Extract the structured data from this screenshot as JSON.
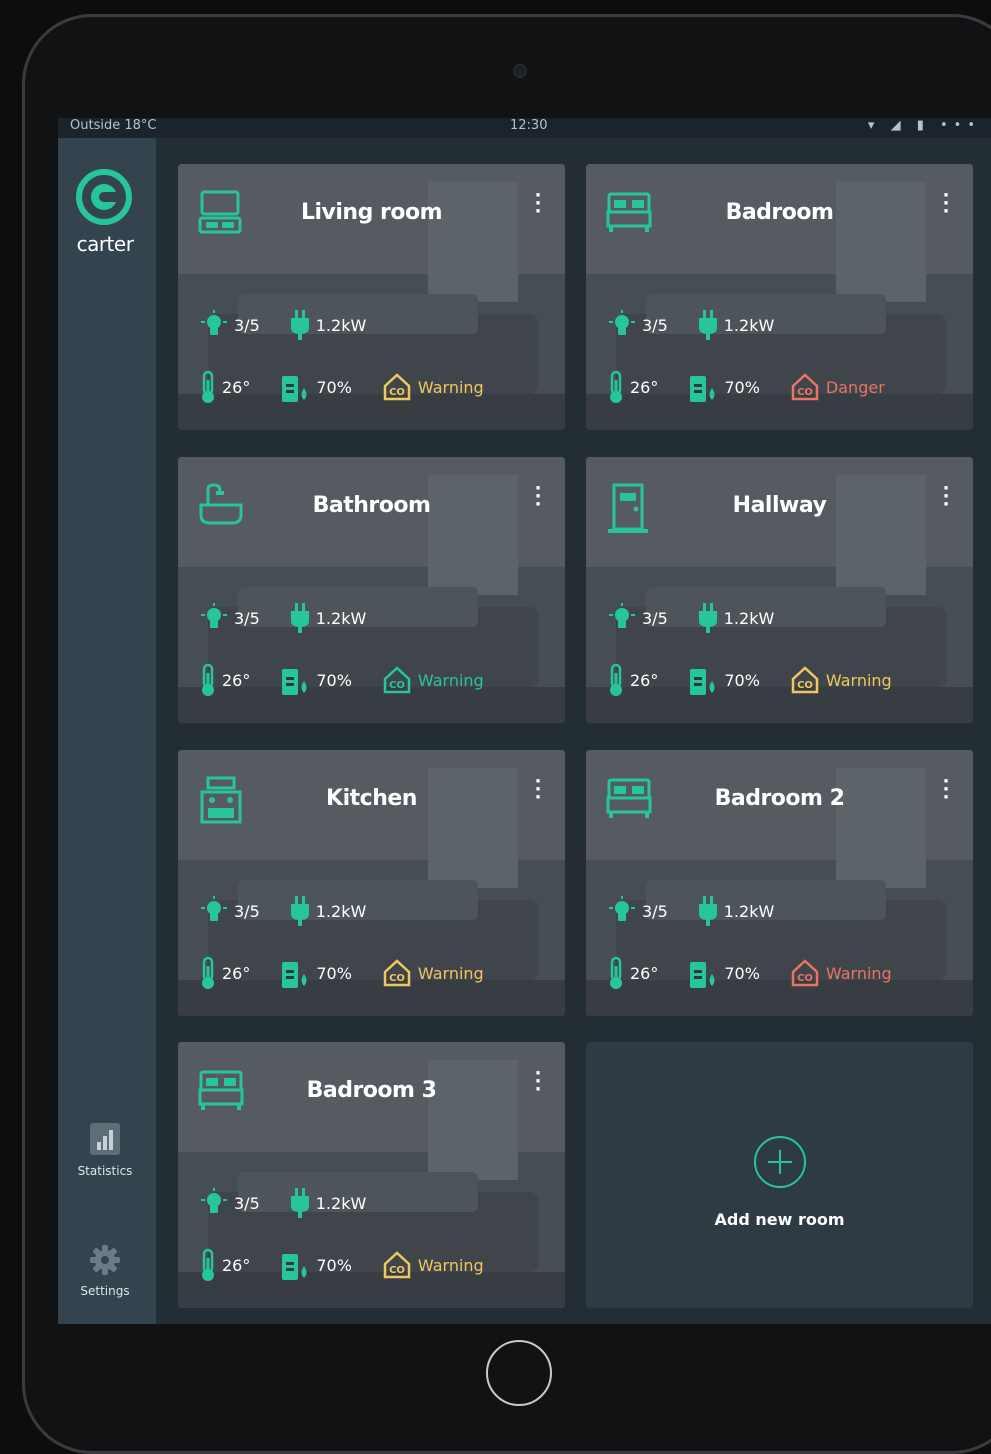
{
  "status_bar": {
    "left": "Outside 18°C",
    "time": "12:30",
    "right": "▾ ◢ ▮ •••"
  },
  "brand": {
    "name": "carter",
    "accent": "#27c59a"
  },
  "sidebar": {
    "items": [
      {
        "label": "Statistics",
        "icon": "bar-chart-icon"
      },
      {
        "label": "Settings",
        "icon": "gear-icon"
      }
    ]
  },
  "rooms": [
    {
      "name": "Living room",
      "icon": "tv-icon",
      "lights": "3/5",
      "power": "1.2kW",
      "temp": "26°",
      "humidity": "70%",
      "co": "Warning",
      "co_level": "warning"
    },
    {
      "name": "Badroom",
      "icon": "bed-icon",
      "lights": "3/5",
      "power": "1.2kW",
      "temp": "26°",
      "humidity": "70%",
      "co": "Danger",
      "co_level": "danger"
    },
    {
      "name": "Bathroom",
      "icon": "bathtub-icon",
      "lights": "3/5",
      "power": "1.2kW",
      "temp": "26°",
      "humidity": "70%",
      "co": "Warning",
      "co_level": "ok"
    },
    {
      "name": "Hallway",
      "icon": "door-icon",
      "lights": "3/5",
      "power": "1.2kW",
      "temp": "26°",
      "humidity": "70%",
      "co": "Warning",
      "co_level": "warning"
    },
    {
      "name": "Kitchen",
      "icon": "stove-icon",
      "lights": "3/5",
      "power": "1.2kW",
      "temp": "26°",
      "humidity": "70%",
      "co": "Warning",
      "co_level": "warning"
    },
    {
      "name": "Badroom 2",
      "icon": "bed-icon",
      "lights": "3/5",
      "power": "1.2kW",
      "temp": "26°",
      "humidity": "70%",
      "co": "Warning",
      "co_level": "danger"
    },
    {
      "name": "Badroom 3",
      "icon": "bed-icon",
      "lights": "3/5",
      "power": "1.2kW",
      "temp": "26°",
      "humidity": "70%",
      "co": "Warning",
      "co_level": "warning"
    }
  ],
  "add_room": {
    "label": "Add new room"
  },
  "colors": {
    "accent": "#27c59a",
    "warning": "#f0c75e",
    "danger": "#e87461",
    "sidebar": "#34444f"
  }
}
